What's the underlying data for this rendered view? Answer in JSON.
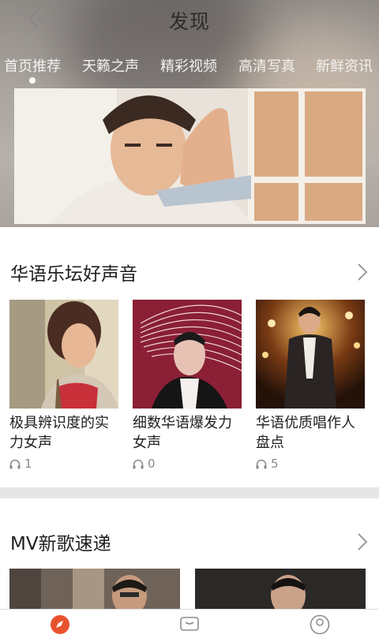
{
  "header": {
    "title": "发现",
    "back_icon": "chevron-left-icon",
    "tabs": [
      {
        "label": "首页推荐",
        "active": true
      },
      {
        "label": "天籁之声",
        "active": false
      },
      {
        "label": "精彩视频",
        "active": false
      },
      {
        "label": "高清写真",
        "active": false
      },
      {
        "label": "新鲜资讯",
        "active": false
      }
    ]
  },
  "section1": {
    "title": "华语乐坛好声音",
    "cards": [
      {
        "title": "极具辨识度的实力女声",
        "plays": "1",
        "icon": "headphones-icon"
      },
      {
        "title": "细数华语爆发力女声",
        "plays": "0",
        "icon": "headphones-icon"
      },
      {
        "title": "华语优质唱作人盘点",
        "plays": "5",
        "icon": "headphones-icon"
      }
    ]
  },
  "section2": {
    "title": "MV新歌速递"
  },
  "bottom_nav": [
    {
      "icon": "compass-icon",
      "active": true
    },
    {
      "icon": "chat-icon",
      "active": false
    },
    {
      "icon": "user-icon",
      "active": false
    }
  ],
  "colors": {
    "accent": "#e8532f",
    "divider": "#e6e6e6"
  }
}
